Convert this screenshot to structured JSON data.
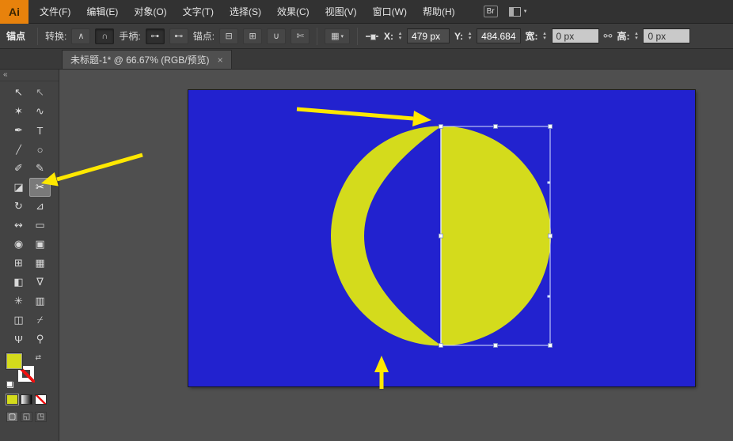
{
  "app": {
    "logo_text": "Ai"
  },
  "menu": {
    "items": [
      "文件(F)",
      "编辑(E)",
      "对象(O)",
      "文字(T)",
      "选择(S)",
      "效果(C)",
      "视图(V)",
      "窗口(W)",
      "帮助(H)"
    ],
    "bridge_label": "Br"
  },
  "control_bar": {
    "anchor_title": "锚点",
    "convert_label": "转换:",
    "handles_label": "手柄:",
    "anchors_label": "锚点:",
    "x_label": "X:",
    "x_value": "479 px",
    "y_label": "Y:",
    "y_value": "484.684",
    "width_label": "宽:",
    "width_value": "0 px",
    "height_label": "高:",
    "height_value": "0 px",
    "icons": {
      "convert_corner": "∧",
      "convert_smooth": "∩",
      "handle_show": "⊶",
      "handle_hide": "⊷",
      "remove_anchor": "⊟",
      "add_anchor": "⊞",
      "connect_endpoints": "∪",
      "cut_path": "✄",
      "menu_grid": "▦",
      "caret_down": "▾",
      "up_arrow": "▴",
      "down_arrow": "▾",
      "link": "⚯"
    }
  },
  "tab": {
    "title": "未标题-1* @ 66.67% (RGB/预览)",
    "close_label": "×"
  },
  "toolbar": {
    "collapse_label": "«",
    "swap_glyph": "⇄",
    "tools": [
      {
        "name": "selection-tool",
        "glyph": "↖"
      },
      {
        "name": "direct-selection-tool",
        "glyph": "↖"
      },
      {
        "name": "magic-wand-tool",
        "glyph": "✶"
      },
      {
        "name": "lasso-tool",
        "glyph": "∿"
      },
      {
        "name": "pen-tool",
        "glyph": "✒"
      },
      {
        "name": "type-tool",
        "glyph": "T"
      },
      {
        "name": "line-segment-tool",
        "glyph": "╱"
      },
      {
        "name": "ellipse-tool",
        "glyph": "○"
      },
      {
        "name": "paintbrush-tool",
        "glyph": "✐"
      },
      {
        "name": "pencil-tool",
        "glyph": "✎"
      },
      {
        "name": "eraser-tool",
        "glyph": "◪"
      },
      {
        "name": "scissors-tool",
        "glyph": "✂",
        "selected": true
      },
      {
        "name": "rotate-tool",
        "glyph": "↻"
      },
      {
        "name": "scale-tool",
        "glyph": "⊿"
      },
      {
        "name": "width-tool",
        "glyph": "↭"
      },
      {
        "name": "free-transform-tool",
        "glyph": "▭"
      },
      {
        "name": "shape-builder-tool",
        "glyph": "◉"
      },
      {
        "name": "live-paint-bucket-tool",
        "glyph": "▣"
      },
      {
        "name": "perspective-grid-tool",
        "glyph": "⊞"
      },
      {
        "name": "mesh-tool",
        "glyph": "▦"
      },
      {
        "name": "gradient-tool",
        "glyph": "◧"
      },
      {
        "name": "eyedropper-tool",
        "glyph": "∇"
      },
      {
        "name": "symbol-sprayer-tool",
        "glyph": "✳"
      },
      {
        "name": "column-graph-tool",
        "glyph": "▥"
      },
      {
        "name": "artboard-tool",
        "glyph": "◫"
      },
      {
        "name": "slice-tool",
        "glyph": "⌿"
      },
      {
        "name": "hand-tool",
        "glyph": "Ψ"
      },
      {
        "name": "zoom-tool",
        "glyph": "⚲"
      }
    ],
    "draw_modes": [
      {
        "name": "draw-normal-button",
        "glyph": "▢",
        "active": true
      },
      {
        "name": "draw-behind-button",
        "glyph": "◱",
        "active": false
      },
      {
        "name": "draw-inside-button",
        "glyph": "◳",
        "active": false
      }
    ]
  },
  "swatches": {
    "fill_color": "#d4db1c"
  },
  "canvas": {
    "artboard_color": "#2222cf",
    "shape_color": "#d4db1c",
    "selection_color": "#eef2ff",
    "arrow_color": "#ffe800"
  }
}
